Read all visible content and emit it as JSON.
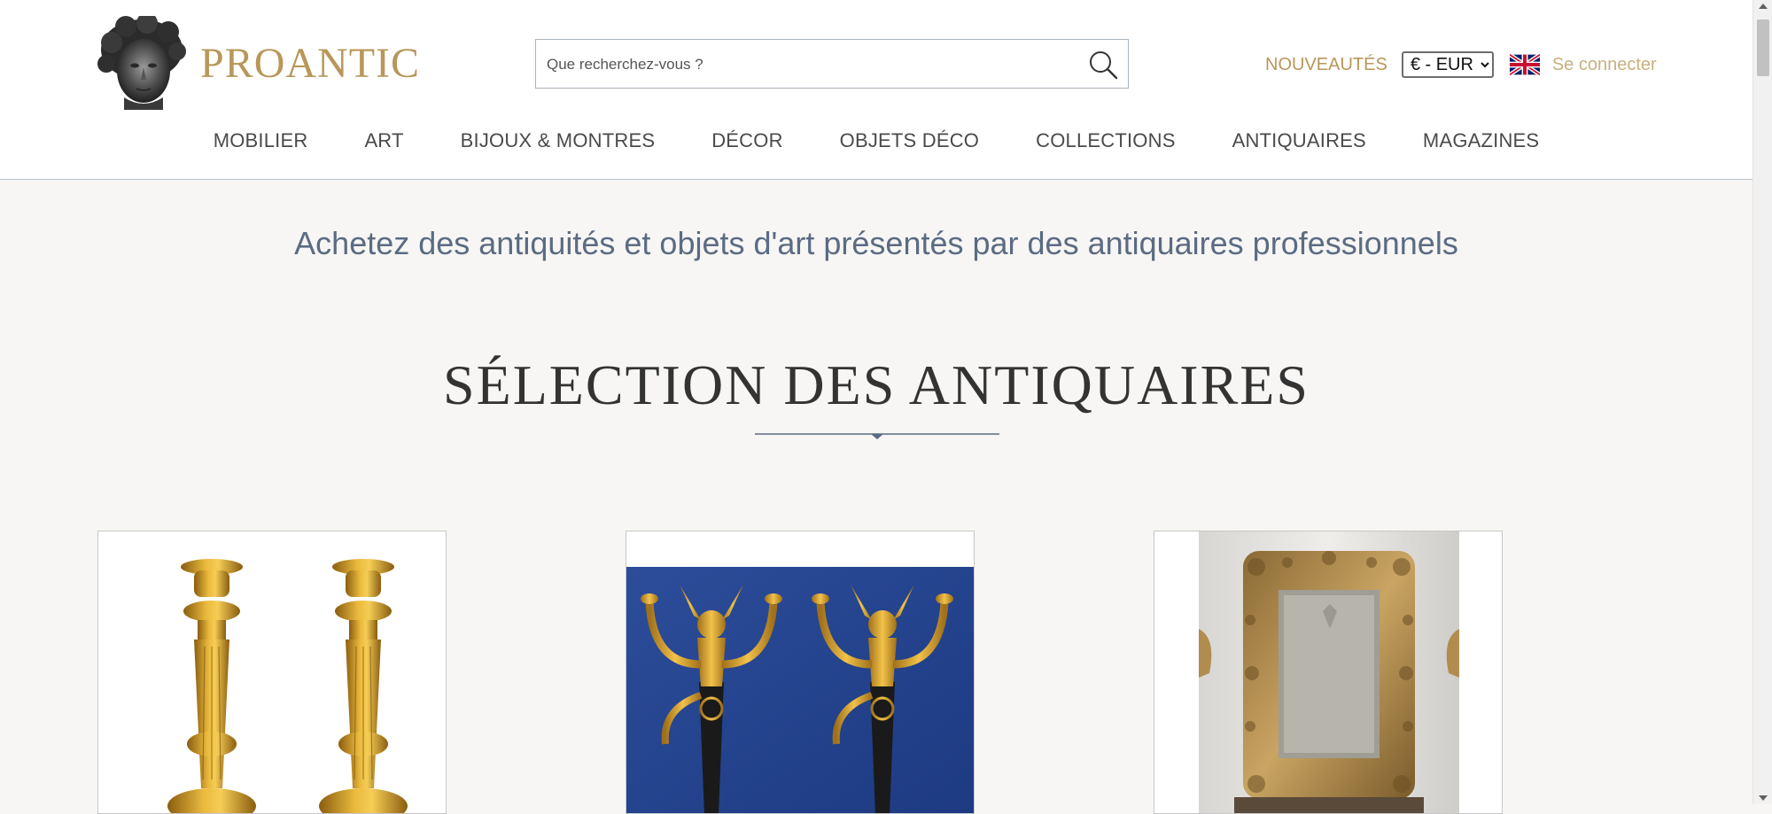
{
  "header": {
    "logo_text": "PROANTIC",
    "search_placeholder": "Que recherchez-vous ?",
    "nouveautes_label": "NOUVEAUTÉS",
    "currency_selected": "€ - EUR",
    "login_label": "Se connecter",
    "language_icon": "uk-flag-icon"
  },
  "nav": {
    "items": [
      "MOBILIER",
      "ART",
      "BIJOUX & MONTRES",
      "DÉCOR",
      "OBJETS DÉCO",
      "COLLECTIONS",
      "ANTIQUAIRES",
      "MAGAZINES"
    ]
  },
  "main": {
    "tagline": "Achetez des antiquités et objets d'art présentés par des antiquaires professionnels",
    "section_title": "SÉLECTION DES ANTIQUAIRES"
  },
  "colors": {
    "brand_gold": "#b8975a",
    "nav_text": "#4a4a4a",
    "tagline": "#5b6b82",
    "background": "#f7f6f4"
  }
}
